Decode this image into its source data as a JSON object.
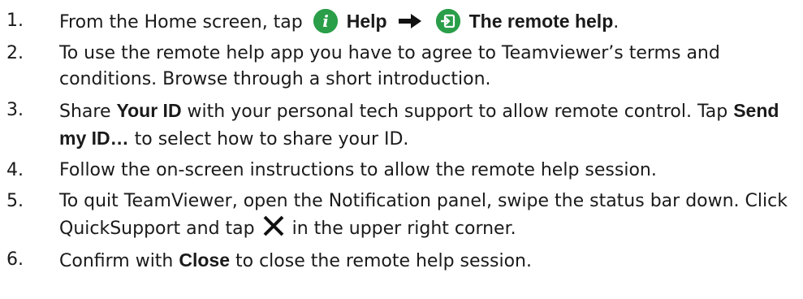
{
  "steps": [
    {
      "num": "1.",
      "parts": {
        "a": "From the Home screen, tap",
        "help": "Help",
        "remote": "The remote help",
        "end": "."
      }
    },
    {
      "num": "2.",
      "text": "To use the remote help app you have to agree to Teamviewer’s terms and conditions. Browse through a short introduction."
    },
    {
      "num": "3.",
      "parts": {
        "a": "Share ",
        "your_id": "Your ID",
        "b": " with your personal tech support to allow remote control. Tap ",
        "send": "Send my ID…",
        "c": " to select how to share your ID."
      }
    },
    {
      "num": "4.",
      "text": "Follow the on-screen instructions to allow the remote help session."
    },
    {
      "num": "5.",
      "parts": {
        "a": "To quit TeamViewer, open the Notification panel, swipe the status bar down. Click QuickSupport and tap",
        "b": "in the upper right corner."
      }
    },
    {
      "num": "6.",
      "parts": {
        "a": "Confirm with ",
        "close": "Close",
        "b": " to close the remote help session."
      }
    }
  ],
  "icons": {
    "info": "info-icon",
    "arrow": "right-arrow-icon",
    "remote": "exit-icon",
    "close": "close-icon"
  },
  "colors": {
    "icon_green": "#2a9e49",
    "text": "#1a1a1a"
  }
}
